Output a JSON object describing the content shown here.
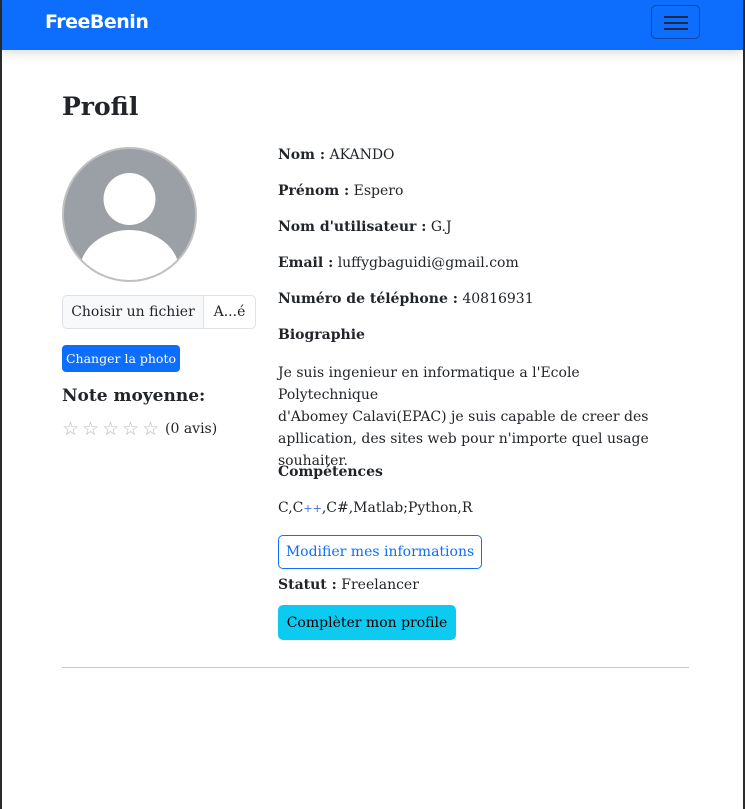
{
  "navbar": {
    "brand": "FreeBenin"
  },
  "page": {
    "title": "Profil"
  },
  "photo": {
    "file_button": "Choisir un fichier",
    "file_name": "A...é",
    "change_button": "Changer la photo"
  },
  "rating": {
    "title": "Note moyenne:",
    "stars_total": 5,
    "stars_filled": 0,
    "count_text": "(0 avis)"
  },
  "profile": {
    "nom_label": "Nom :",
    "nom": "AKANDO",
    "prenom_label": "Prénom :",
    "prenom": "Espero",
    "username_label": "Nom d'utilisateur :",
    "username": "G.J",
    "email_label": "Email :",
    "email": "luffygbaguidi@gmail.com",
    "phone_label": "Numéro de téléphone :",
    "phone": "40816931",
    "bio_title": "Biographie",
    "bio_lines": [
      "Je suis ingenieur en informatique a l'Ecole Polytechnique",
      "d'Abomey Calavi(EPAC) je suis capable de creer des",
      "apllication, des sites web pour n'importe quel usage",
      "souhaiter."
    ],
    "skills_title": "Compétences",
    "skills_parts": [
      "C,C",
      "++",
      ",C#,Matlab;Python,R"
    ],
    "edit_button": "Modifier mes informations",
    "status_label": "Statut :",
    "status": "Freelancer",
    "complete_button": "Complèter mon profile"
  },
  "colors": {
    "primary": "#0d6efd",
    "info": "#0dcaf0"
  }
}
